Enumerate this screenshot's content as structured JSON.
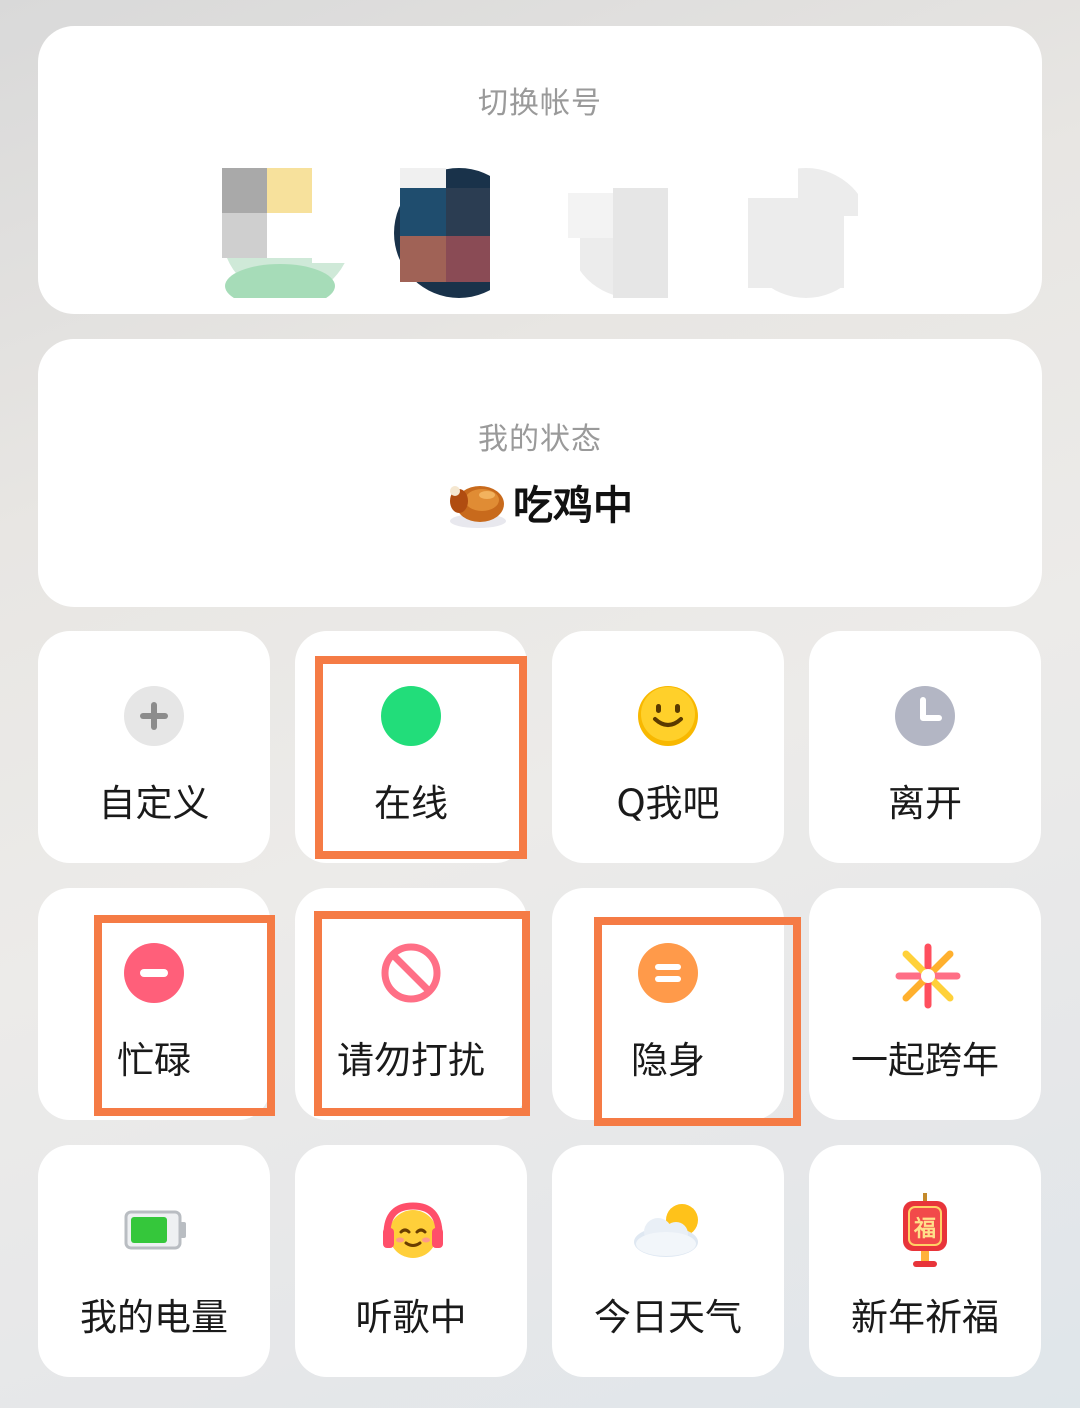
{
  "account_switch": {
    "title": "切换帐号"
  },
  "my_status": {
    "title": "我的状态",
    "current": "吃鸡中"
  },
  "status_tiles": [
    {
      "label": "自定义",
      "icon": "plus-icon"
    },
    {
      "label": "在线",
      "icon": "online-dot-icon"
    },
    {
      "label": "Q我吧",
      "icon": "smile-icon"
    },
    {
      "label": "离开",
      "icon": "clock-icon"
    },
    {
      "label": "忙碌",
      "icon": "busy-minus-icon"
    },
    {
      "label": "请勿打扰",
      "icon": "no-disturb-icon"
    },
    {
      "label": "隐身",
      "icon": "invisible-icon"
    },
    {
      "label": "一起跨年",
      "icon": "firework-icon"
    },
    {
      "label": "我的电量",
      "icon": "battery-icon"
    },
    {
      "label": "听歌中",
      "icon": "headphone-emoji-icon"
    },
    {
      "label": "今日天气",
      "icon": "weather-icon"
    },
    {
      "label": "新年祈福",
      "icon": "fu-lantern-icon"
    }
  ],
  "colors": {
    "highlight": "#f57b45",
    "online": "#22dd7a",
    "busy": "#ff5f7a",
    "invisible": "#ff9a4a"
  }
}
